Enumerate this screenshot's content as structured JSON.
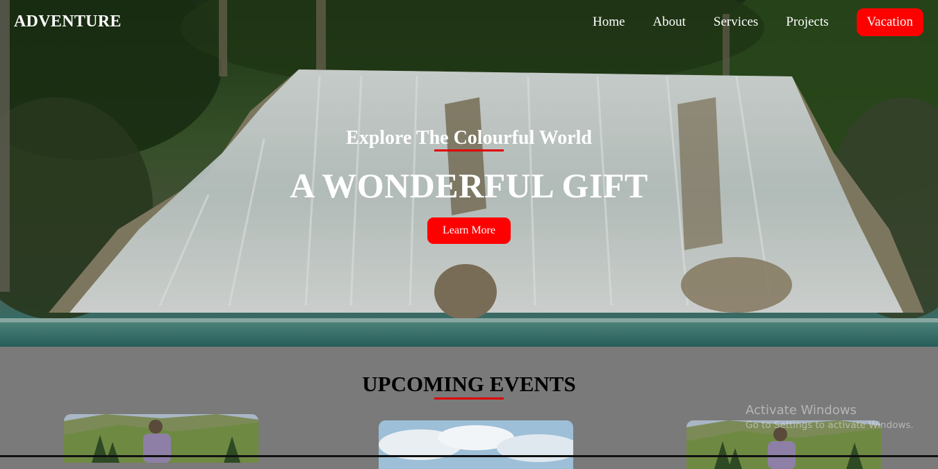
{
  "nav": {
    "logo": "ADVENTURE",
    "links": [
      "Home",
      "About",
      "Services",
      "Projects"
    ],
    "cta": "Vacation"
  },
  "hero": {
    "subtitle": "Explore The Colourful World",
    "title": "A WONDERFUL GIFT",
    "button": "Learn More"
  },
  "events": {
    "title": "UPCOMING EVENTS"
  },
  "watermark": {
    "title": "Activate Windows",
    "subtitle": "Go to Settings to activate Windows."
  },
  "colors": {
    "accent": "#ff0000",
    "section_bg": "#7a7a7a"
  }
}
